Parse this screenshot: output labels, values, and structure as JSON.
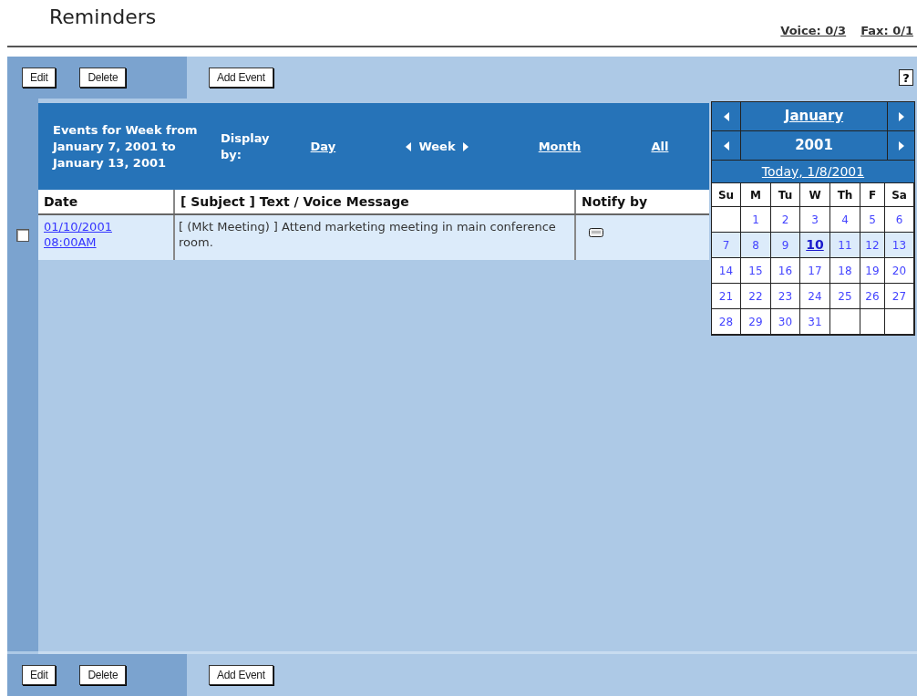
{
  "title": "Reminders",
  "quota_links": [
    "Voice: 0/3",
    "Fax: 0/1"
  ],
  "toolbar_top": {
    "buttons": [
      "Edit",
      "Delete"
    ],
    "add_button": "Add Event",
    "help": "?"
  },
  "events": {
    "heading": "Events for Week from January 7, 2001 to January 13, 2001",
    "display_label": "Display by:",
    "views": [
      {
        "label": "Day",
        "kind": "link"
      },
      {
        "label": "Week",
        "kind": "stepper"
      },
      {
        "label": "Month",
        "kind": "link"
      },
      {
        "label": "All",
        "kind": "link"
      }
    ],
    "columns": [
      "Date",
      "[ Subject ] Text / Voice Message",
      "Notify by"
    ],
    "rows": [
      {
        "checked": false,
        "date": "01/10/2001",
        "time": "08:00AM",
        "message": "[ (Mkt Meeting) ] Attend marketing meeting in main conference room."
      }
    ]
  },
  "calendar": {
    "month": "January",
    "year": "2001",
    "today": "Today, 1/8/2001",
    "weekdays": [
      "Su",
      "M",
      "Tu",
      "W",
      "Th",
      "F",
      "Sa"
    ],
    "weeks": [
      {
        "selected": false,
        "days": [
          {
            "kind": "blank"
          },
          {
            "kind": "day",
            "day": "1",
            "selected": false
          },
          {
            "kind": "day",
            "day": "2",
            "selected": false
          },
          {
            "kind": "day",
            "day": "3",
            "selected": false
          },
          {
            "kind": "day",
            "day": "4",
            "selected": false
          },
          {
            "kind": "day",
            "day": "5",
            "selected": false
          },
          {
            "kind": "day",
            "day": "6",
            "selected": false
          }
        ]
      },
      {
        "selected": true,
        "days": [
          {
            "kind": "day",
            "day": "7",
            "selected": false
          },
          {
            "kind": "day",
            "day": "8",
            "selected": false
          },
          {
            "kind": "day",
            "day": "9",
            "selected": false
          },
          {
            "kind": "day",
            "day": "10",
            "selected": true
          },
          {
            "kind": "day",
            "day": "11",
            "selected": false
          },
          {
            "kind": "day",
            "day": "12",
            "selected": false
          },
          {
            "kind": "day",
            "day": "13",
            "selected": false
          }
        ]
      },
      {
        "selected": false,
        "days": [
          {
            "kind": "day",
            "day": "14",
            "selected": false
          },
          {
            "kind": "day",
            "day": "15",
            "selected": false
          },
          {
            "kind": "day",
            "day": "16",
            "selected": false
          },
          {
            "kind": "day",
            "day": "17",
            "selected": false
          },
          {
            "kind": "day",
            "day": "18",
            "selected": false
          },
          {
            "kind": "day",
            "day": "19",
            "selected": false
          },
          {
            "kind": "day",
            "day": "20",
            "selected": false
          }
        ]
      },
      {
        "selected": false,
        "days": [
          {
            "kind": "day",
            "day": "21",
            "selected": false
          },
          {
            "kind": "day",
            "day": "22",
            "selected": false
          },
          {
            "kind": "day",
            "day": "23",
            "selected": false
          },
          {
            "kind": "day",
            "day": "24",
            "selected": false
          },
          {
            "kind": "day",
            "day": "25",
            "selected": false
          },
          {
            "kind": "day",
            "day": "26",
            "selected": false
          },
          {
            "kind": "day",
            "day": "27",
            "selected": false
          }
        ]
      },
      {
        "selected": false,
        "days": [
          {
            "kind": "day",
            "day": "28",
            "selected": false
          },
          {
            "kind": "day",
            "day": "29",
            "selected": false
          },
          {
            "kind": "day",
            "day": "30",
            "selected": false
          },
          {
            "kind": "day",
            "day": "31",
            "selected": false
          },
          {
            "kind": "blank"
          },
          {
            "kind": "blank"
          },
          {
            "kind": "blank"
          }
        ]
      }
    ]
  },
  "toolbar_bottom": {
    "buttons": [
      "Edit",
      "Delete"
    ],
    "add_button": "Add Event"
  }
}
